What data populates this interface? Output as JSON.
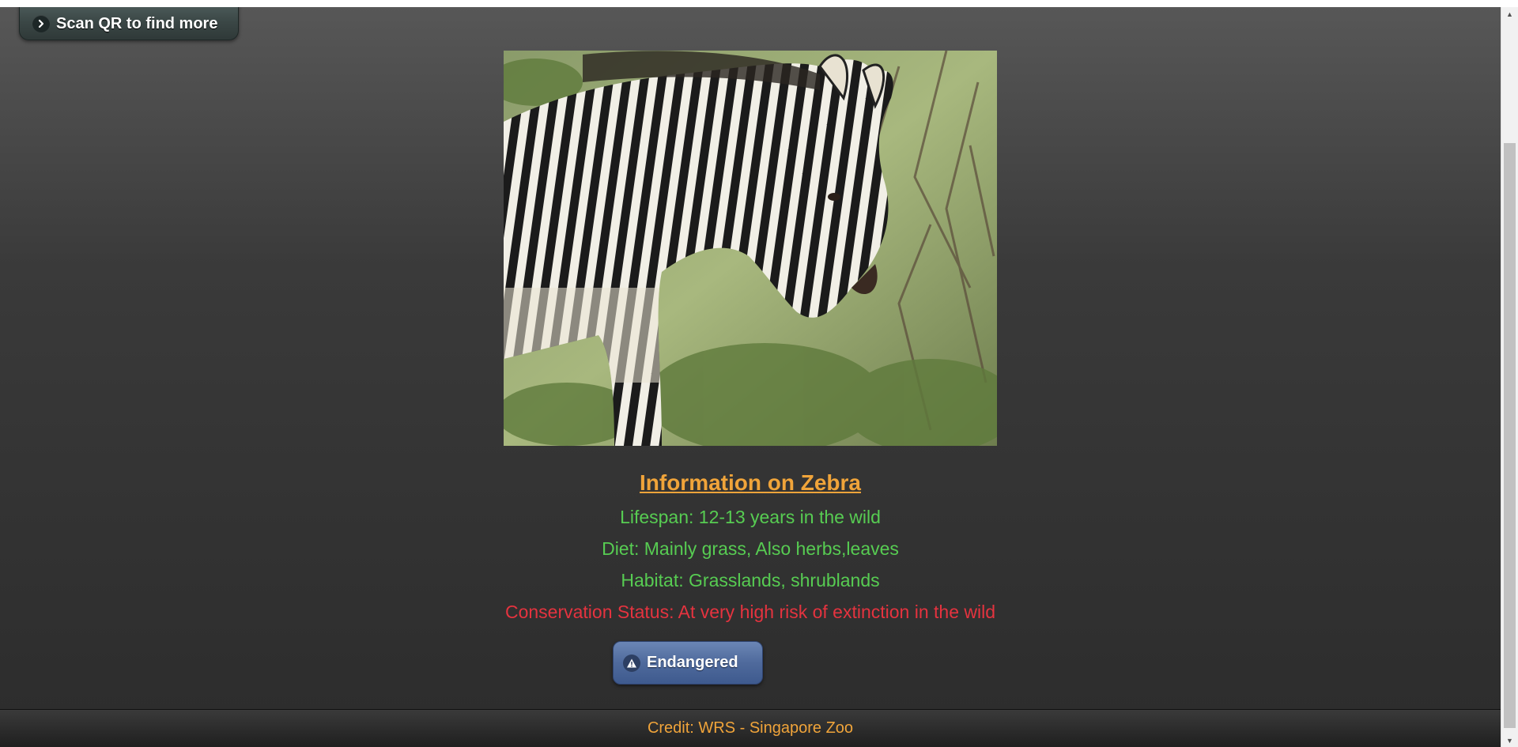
{
  "header": {
    "scan_button_label": "Scan QR to find more",
    "scan_button_icon": "chevron-right-icon"
  },
  "photo": {
    "subject": "zebra-photo"
  },
  "info": {
    "title": "Information on Zebra",
    "lifespan": "Lifespan: 12-13 years in the wild",
    "diet": "Diet: Mainly grass, Also herbs,leaves",
    "habitat": "Habitat: Grasslands, shrublands",
    "conservation": "Conservation Status: At very high risk of extinction in the wild"
  },
  "status_button": {
    "label": "Endangered",
    "icon": "warning-icon"
  },
  "footer": {
    "credit": "Credit: WRS - Singapore Zoo"
  },
  "colors": {
    "title": "#f0a43a",
    "info_text": "#57cc52",
    "conservation_text": "#e5333f",
    "credit_text": "#f0a43a",
    "status_button": "#4f6a9c"
  }
}
